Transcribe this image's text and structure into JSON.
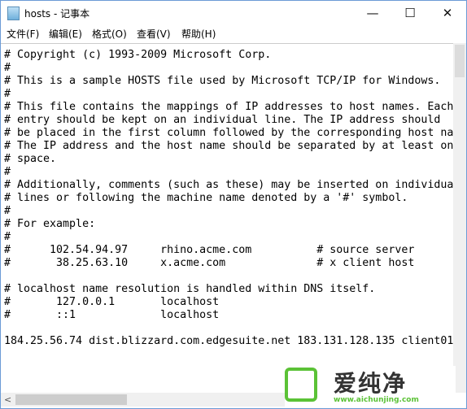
{
  "window": {
    "title": "hosts - 记事本",
    "minimize": "—",
    "maximize": "☐",
    "close": "✕"
  },
  "menu": [
    "文件(F)",
    "编辑(E)",
    "格式(O)",
    "查看(V)",
    "帮助(H)"
  ],
  "lines": [
    "# Copyright (c) 1993-2009 Microsoft Corp.",
    "#",
    "# This is a sample HOSTS file used by Microsoft TCP/IP for Windows.",
    "#",
    "# This file contains the mappings of IP addresses to host names. Each",
    "# entry should be kept on an individual line. The IP address should",
    "# be placed in the first column followed by the corresponding host name.",
    "# The IP address and the host name should be separated by at least one",
    "# space.",
    "#",
    "# Additionally, comments (such as these) may be inserted on individual",
    "# lines or following the machine name denoted by a '#' symbol.",
    "#",
    "# For example:",
    "#",
    "#      102.54.94.97     rhino.acme.com          # source server",
    "#       38.25.63.10     x.acme.com              # x client host",
    "",
    "# localhost name resolution is handled within DNS itself.",
    "#       127.0.0.1       localhost",
    "#       ::1             localhost",
    "",
    "184.25.56.74 dist.blizzard.com.edgesuite.net 183.131.128.135 client01"
  ],
  "scroll": {
    "left_arrow": "<"
  },
  "watermark": {
    "text": "爱纯净",
    "url": "www.aichunjing.com",
    "color": "#5bc236"
  }
}
